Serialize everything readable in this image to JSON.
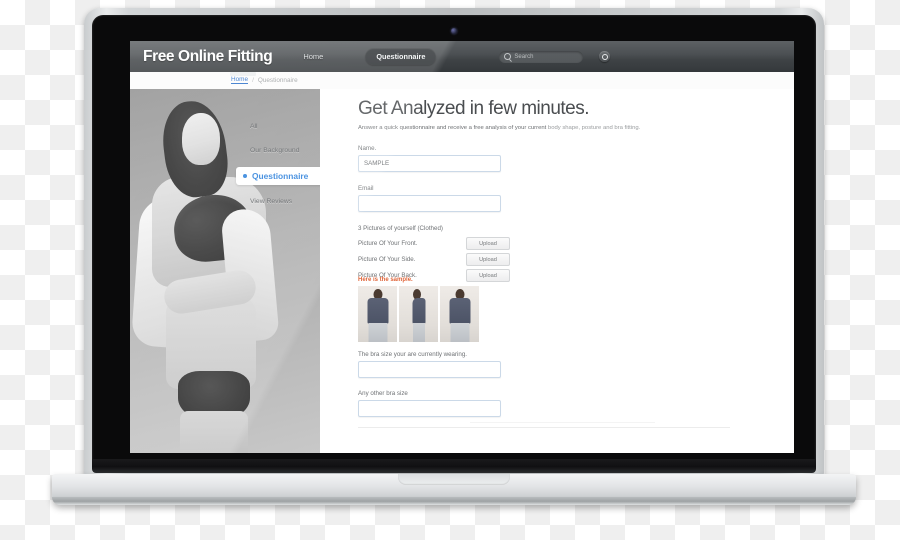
{
  "site": {
    "brand": "Free Online Fitting",
    "nav": {
      "home": "Home",
      "questionnaire": "Questionnaire"
    },
    "search": {
      "placeholder": "Search",
      "icon": "search-icon"
    },
    "settings_icon": "gear-icon"
  },
  "breadcrumb": {
    "home": "Home",
    "separator": "/",
    "current": "Questionnaire"
  },
  "sidebar": {
    "items": [
      {
        "label": "All",
        "active": false
      },
      {
        "label": "Our Background",
        "active": false
      },
      {
        "label": "Questionnaire",
        "active": true
      },
      {
        "label": "View Reviews",
        "active": false
      }
    ],
    "active_color": "#2a7fdb"
  },
  "main": {
    "heading": "Get Analyzed in few minutes.",
    "lede_strong": "Answer a quick questionnaire and receive a free analysis of your current ",
    "lede_soft": "body shape, posture and bra fitting.",
    "fields": {
      "name": {
        "label": "Name.",
        "value": "SAMPLE"
      },
      "email": {
        "label": "Email",
        "value": ""
      },
      "current_bra": {
        "label": "The bra size your are currently wearing.",
        "value": ""
      },
      "other_bra": {
        "label": "Any other bra size",
        "value": ""
      }
    },
    "pictures": {
      "section_label": "3 Pictures of yourself (Clothed)",
      "rows": [
        {
          "label": "Picture Of Your Front.",
          "button": "Upload"
        },
        {
          "label": "Picture Of Your Side.",
          "button": "Upload"
        },
        {
          "label": "Picture Of Your Back.",
          "button": "Upload"
        }
      ],
      "sample_note": "Here is the sample.",
      "sample_note_color": "#e0653a",
      "sample_alts": [
        "sample-front-photo",
        "sample-side-photo",
        "sample-back-photo"
      ]
    }
  },
  "device": {
    "type": "laptop-mockup",
    "webcam": "webcam-dot"
  }
}
